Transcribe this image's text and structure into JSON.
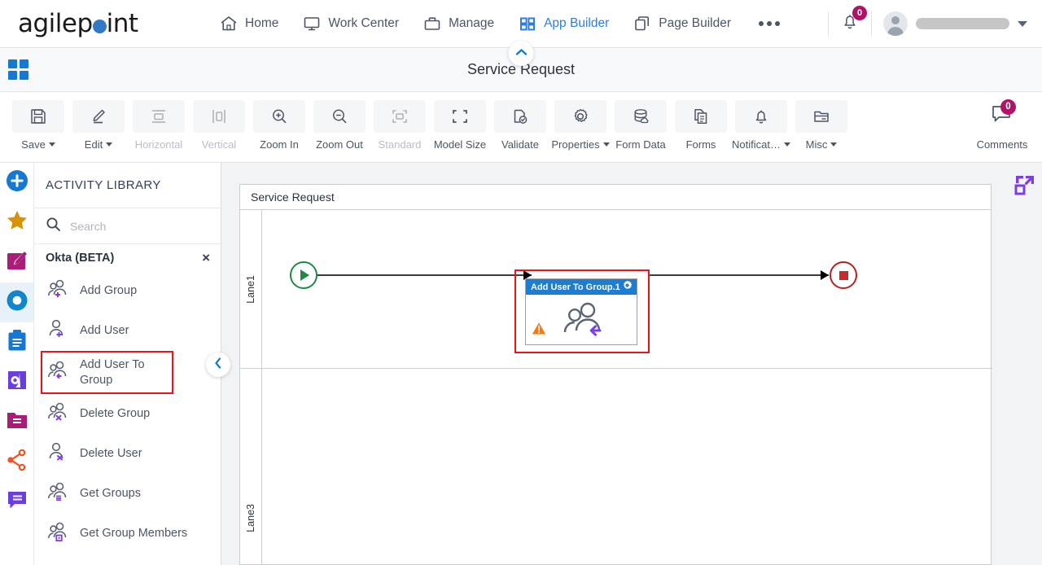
{
  "topnav": {
    "brand": {
      "part1": "agilep",
      "part2": "int"
    },
    "items": [
      {
        "label": "Home",
        "icon": "home-icon",
        "active": false
      },
      {
        "label": "Work Center",
        "icon": "monitor-icon",
        "active": false
      },
      {
        "label": "Manage",
        "icon": "briefcase-icon",
        "active": false
      },
      {
        "label": "App Builder",
        "icon": "grid-icon",
        "active": true
      },
      {
        "label": "Page Builder",
        "icon": "pages-icon",
        "active": false
      }
    ],
    "more_label": "•••",
    "notification_count": "0",
    "user_name": ""
  },
  "titlebar": {
    "app_title": "Service Request"
  },
  "toolbar": {
    "buttons": [
      {
        "label": "Save",
        "icon": "save-icon",
        "caret": true,
        "disabled": false
      },
      {
        "label": "Edit",
        "icon": "pencil-icon",
        "caret": true,
        "disabled": false
      },
      {
        "label": "Horizontal",
        "icon": "horizontal-align-icon",
        "caret": false,
        "disabled": true
      },
      {
        "label": "Vertical",
        "icon": "vertical-align-icon",
        "caret": false,
        "disabled": true
      },
      {
        "label": "Zoom In",
        "icon": "zoom-in-icon",
        "caret": false,
        "disabled": false
      },
      {
        "label": "Zoom Out",
        "icon": "zoom-out-icon",
        "caret": false,
        "disabled": false
      },
      {
        "label": "Standard",
        "icon": "standard-size-icon",
        "caret": false,
        "disabled": true
      },
      {
        "label": "Model Size",
        "icon": "model-size-icon",
        "caret": false,
        "disabled": false
      },
      {
        "label": "Validate",
        "icon": "validate-icon",
        "caret": false,
        "disabled": false
      },
      {
        "label": "Properties",
        "icon": "gear-icon",
        "caret": true,
        "disabled": false
      },
      {
        "label": "Form Data",
        "icon": "database-icon",
        "caret": false,
        "disabled": false
      },
      {
        "label": "Forms",
        "icon": "forms-icon",
        "caret": false,
        "disabled": false
      },
      {
        "label": "Notificat…",
        "icon": "bell-icon",
        "caret": true,
        "disabled": false
      },
      {
        "label": "Misc",
        "icon": "folder-icon",
        "caret": true,
        "disabled": false
      }
    ],
    "comments": {
      "label": "Comments",
      "icon": "comment-icon",
      "count": "0"
    }
  },
  "rail": {
    "items": [
      {
        "name": "add-icon",
        "selected": false
      },
      {
        "name": "star-icon",
        "selected": false
      },
      {
        "name": "edit-square-icon",
        "selected": false
      },
      {
        "name": "ring-icon",
        "selected": true
      },
      {
        "name": "clipboard-icon",
        "selected": false
      },
      {
        "name": "agile-icon",
        "selected": false
      },
      {
        "name": "folder-icon",
        "selected": false
      },
      {
        "name": "hubspot-icon",
        "selected": false
      },
      {
        "name": "chat-icon",
        "selected": false
      }
    ]
  },
  "panel": {
    "title": "ACTIVITY LIBRARY",
    "search": {
      "placeholder": "Search",
      "value": ""
    },
    "group": {
      "label": "Okta (BETA)",
      "close": "×"
    },
    "activities": [
      {
        "label": "Add Group",
        "icon": "add-group-icon",
        "highlighted": false
      },
      {
        "label": "Add User",
        "icon": "add-user-icon",
        "highlighted": false
      },
      {
        "label": "Add User To Group",
        "icon": "add-user-to-group-icon",
        "highlighted": true
      },
      {
        "label": "Delete Group",
        "icon": "delete-group-icon",
        "highlighted": false
      },
      {
        "label": "Delete User",
        "icon": "delete-user-icon",
        "highlighted": false
      },
      {
        "label": "Get Groups",
        "icon": "get-groups-icon",
        "highlighted": false
      },
      {
        "label": "Get Group Members",
        "icon": "get-group-members-icon",
        "highlighted": false
      }
    ]
  },
  "canvas": {
    "pool_title": "Service Request",
    "lanes": [
      {
        "label": "Lane1"
      },
      {
        "label": ""
      },
      {
        "label": "Lane3"
      }
    ],
    "nodes": {
      "start": {
        "name": "start-event",
        "icon": "play-icon"
      },
      "activity": {
        "title": "Add User To Group.1",
        "gear": "gear-icon",
        "warning": "warning-icon",
        "icon": "add-user-to-group-icon",
        "highlighted": true
      },
      "end": {
        "name": "end-event",
        "icon": "stop-icon"
      }
    },
    "expand_icon": "expand-icon"
  },
  "colors": {
    "accent_blue": "#2f7de1",
    "badge_magenta": "#b01268",
    "highlight_red": "#e8151b",
    "node_header_blue": "#1e7dd0",
    "start_green": "#1f8a45",
    "end_red": "#b32222",
    "warning_orange": "#ef7d17",
    "purple": "#7b3fe4"
  }
}
